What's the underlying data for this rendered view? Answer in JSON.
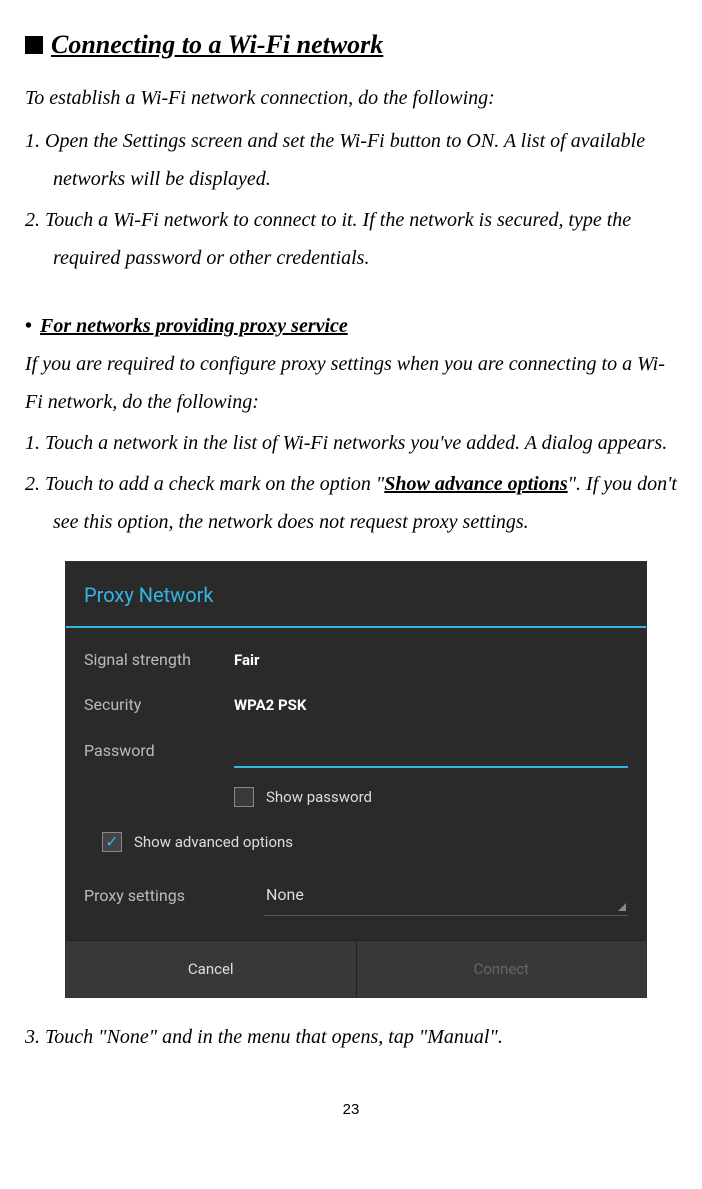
{
  "heading": "Connecting to a Wi-Fi network",
  "intro": "To establish a Wi-Fi network connection, do the following:",
  "step1": "1. Open the Settings screen and set the Wi-Fi button to ON. A list of available networks will be displayed.",
  "step2": "2. Touch a Wi-Fi network to connect to it. If the network is secured, type the required password or other credentials.",
  "subheading": "For networks providing proxy service",
  "proxy_intro": "If you are required to configure proxy settings when you are connecting to a Wi-Fi network, do the following:",
  "proxy_step1": "1. Touch a network in the list of Wi-Fi networks you've added. A dialog appears.",
  "proxy_step2_prefix": "2. Touch to add a check mark on the option \"",
  "proxy_step2_bold": "Show advance options",
  "proxy_step2_suffix": "\". If you don't see this option, the network does not request proxy settings.",
  "dialog": {
    "title": "Proxy Network",
    "signal_label": "Signal strength",
    "signal_value": "Fair",
    "security_label": "Security",
    "security_value": "WPA2 PSK",
    "password_label": "Password",
    "show_password": "Show password",
    "show_advanced": "Show advanced options",
    "proxy_settings_label": "Proxy settings",
    "proxy_settings_value": "None",
    "cancel": "Cancel",
    "connect": "Connect"
  },
  "proxy_step3": "3. Touch \"None\" and in the menu that opens, tap \"Manual\".",
  "page_number": "23"
}
